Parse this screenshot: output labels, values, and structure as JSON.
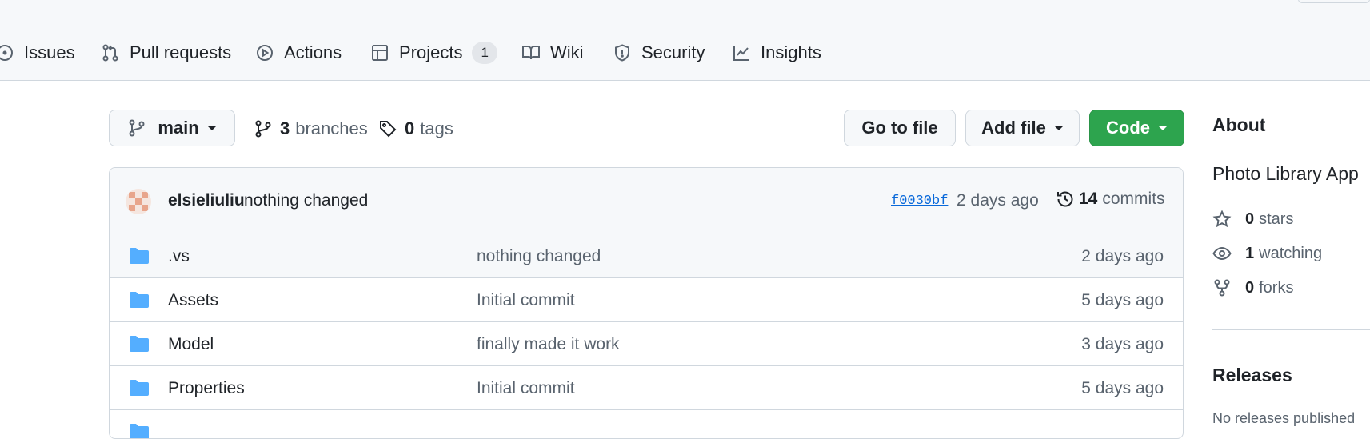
{
  "nav": {
    "issues": "Issues",
    "pull_requests": "Pull requests",
    "actions": "Actions",
    "projects": "Projects",
    "projects_count": "1",
    "wiki": "Wiki",
    "security": "Security",
    "insights": "Insights"
  },
  "repo_bar": {
    "branch": "main",
    "branches_count": "3",
    "branches_label": "branches",
    "tags_count": "0",
    "tags_label": "tags",
    "go_to_file": "Go to file",
    "add_file": "Add file",
    "code": "Code"
  },
  "latest_commit": {
    "author": "elsieliuliu",
    "message": "nothing changed",
    "sha": "f0030bf",
    "time": "2 days ago",
    "commits_count": "14",
    "commits_label": "commits"
  },
  "files": [
    {
      "name": ".vs",
      "message": "nothing changed",
      "time": "2 days ago"
    },
    {
      "name": "Assets",
      "message": "Initial commit",
      "time": "5 days ago"
    },
    {
      "name": "Model",
      "message": "finally made it work",
      "time": "3 days ago"
    },
    {
      "name": "Properties",
      "message": "Initial commit",
      "time": "5 days ago"
    }
  ],
  "about": {
    "heading": "About",
    "description": "Photo Library App",
    "stars_count": "0",
    "stars_label": "stars",
    "watching_count": "1",
    "watching_label": "watching",
    "forks_count": "0",
    "forks_label": "forks"
  },
  "releases": {
    "heading": "Releases",
    "empty_text": "No releases published"
  },
  "colors": {
    "accent_green": "#2da44e",
    "link_blue": "#0969da",
    "folder_blue": "#54aeff"
  }
}
